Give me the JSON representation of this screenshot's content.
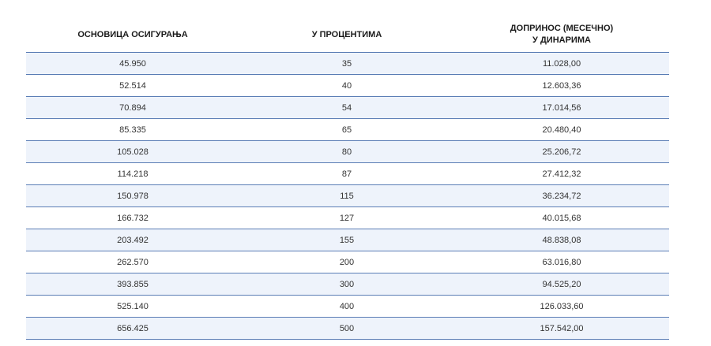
{
  "table": {
    "headers": [
      {
        "lines": [
          "ОСНОВИЦА ОСИГУРАЊА"
        ]
      },
      {
        "lines": [
          "У ПРОЦЕНТИМА"
        ]
      },
      {
        "lines": [
          "ДОПРИНОС (МЕСЕЧНО)",
          "У ДИНАРИМА"
        ]
      }
    ],
    "rows": [
      [
        "45.950",
        "35",
        "11.028,00"
      ],
      [
        "52.514",
        "40",
        "12.603,36"
      ],
      [
        "70.894",
        "54",
        "17.014,56"
      ],
      [
        "85.335",
        "65",
        "20.480,40"
      ],
      [
        "105.028",
        "80",
        "25.206,72"
      ],
      [
        "114.218",
        "87",
        "27.412,32"
      ],
      [
        "150.978",
        "115",
        "36.234,72"
      ],
      [
        "166.732",
        "127",
        "40.015,68"
      ],
      [
        "203.492",
        "155",
        "48.838,08"
      ],
      [
        "262.570",
        "200",
        "63.016,80"
      ],
      [
        "393.855",
        "300",
        "94.525,20"
      ],
      [
        "525.140",
        "400",
        "126.033,60"
      ],
      [
        "656.425",
        "500",
        "157.542,00"
      ]
    ]
  },
  "colors": {
    "row_stripe": "#eef3fb",
    "row_border": "#5a7db5",
    "text": "#333333"
  }
}
